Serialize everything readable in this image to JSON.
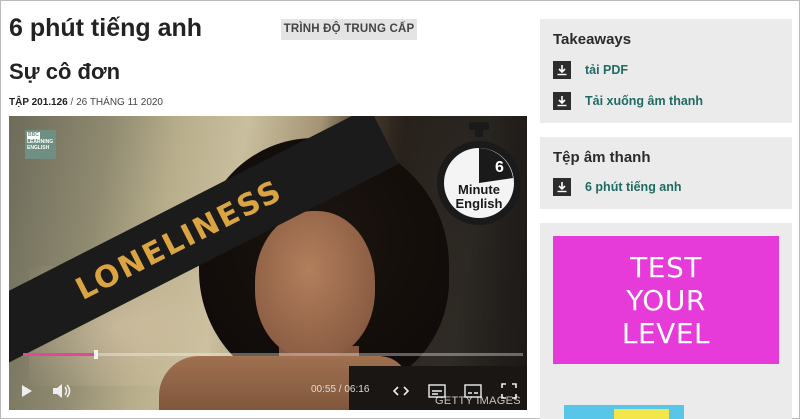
{
  "header": {
    "series_title": "6 phút tiếng anh",
    "level_badge": "TRÌNH ĐỘ TRUNG CẤP",
    "episode_title": "Sự cô đơn",
    "episode_label": "TẬP 201.126",
    "episode_separator": " / ",
    "episode_date": "26 THÁNG 11 2020"
  },
  "video": {
    "banner_text": "LONELINESS",
    "logo_lines": [
      "BBC",
      "LEARNING",
      "ENGLISH"
    ],
    "timer_number": "6",
    "timer_line1": "Minute",
    "timer_line2": "English",
    "current_time": "00:55",
    "duration": "06:16",
    "time_separator": " / ",
    "progress": 0.145,
    "credit": "GETTY IMAGES",
    "colors": {
      "banner_text": "#d9a441",
      "progress": "#e0499b"
    }
  },
  "sidebar": {
    "takeaways": {
      "title": "Takeaways",
      "items": [
        {
          "label": "tải PDF",
          "icon": "download-icon"
        },
        {
          "label": "Tải xuống âm thanh",
          "icon": "download-icon"
        }
      ]
    },
    "audio_file": {
      "title": "Tệp âm thanh",
      "items": [
        {
          "label": "6 phút tiếng anh",
          "icon": "download-icon"
        }
      ]
    },
    "ad": {
      "lines": [
        "TEST",
        "YOUR",
        "LEVEL"
      ],
      "color": "#e63ad9"
    }
  }
}
